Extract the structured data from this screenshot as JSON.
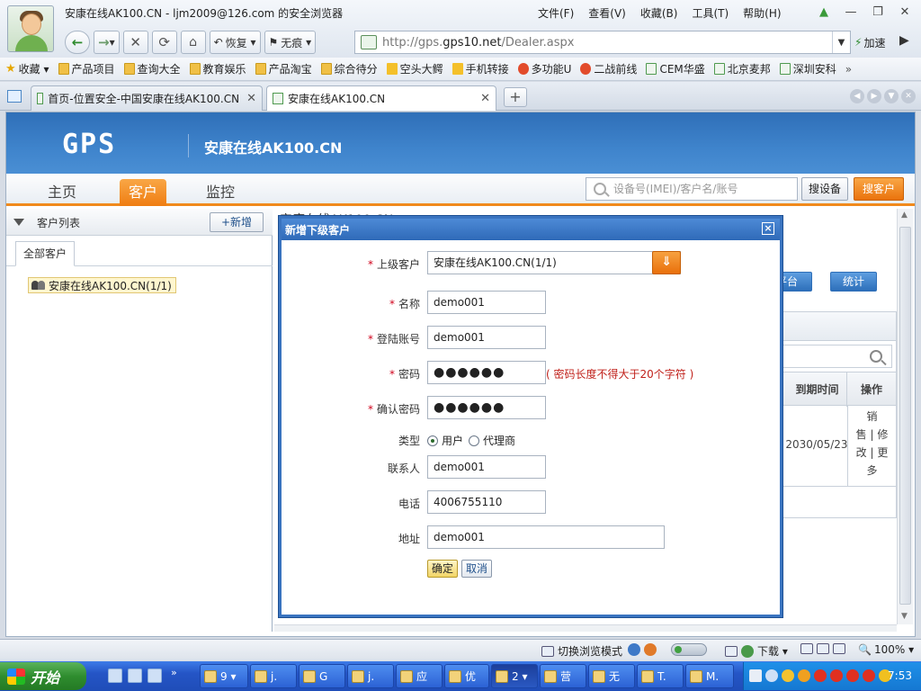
{
  "browser": {
    "window_title": "安康在线AK100.CN - ljm2009@126.com 的安全浏览器",
    "menu": [
      "文件(F)",
      "查看(V)",
      "收藏(B)",
      "工具(T)",
      "帮助(H)"
    ],
    "nav": {
      "restore": "恢复",
      "no_trace": "无痕"
    },
    "url_prefix": "http://gps.",
    "url_domain": "gps10.net",
    "url_path": "/Dealer.aspx",
    "speed_label": "加速",
    "favorites": [
      "收藏",
      "产品项目",
      "查询大全",
      "教育娱乐",
      "产品淘宝",
      "综合待分",
      "空头大鳄",
      "手机转接",
      "多功能U",
      "二战前线",
      "CEM华盛",
      "北京麦邦",
      "深圳安科"
    ],
    "tabs": [
      {
        "label": "首页-位置安全-中国安康在线AK100.CN"
      },
      {
        "label": "安康在线AK100.CN"
      }
    ]
  },
  "site": {
    "logo": "GPS",
    "name": "安康在线AK100.CN",
    "nav": [
      "主页",
      "客户",
      "监控"
    ],
    "search_placeholder": "设备号(IMEI)/客户名/账号",
    "search_device_btn": "搜设备",
    "search_customer_btn": "搜客户"
  },
  "left_panel": {
    "title": "客户列表",
    "add_btn": "+新增",
    "tab_all": "全部客户",
    "tree_node": "安康在线AK100.CN(1/1)"
  },
  "right_panel": {
    "title": "安康在线AK100.CN",
    "btn_platform": "平台",
    "btn_stats": "统计",
    "col_expire": "到期时间",
    "col_ops": "操作",
    "row_expire": "2030/05/23",
    "row_ops": [
      "销",
      "售 | 修",
      "改 | 更",
      "多"
    ]
  },
  "dialog": {
    "title": "新增下级客户",
    "close": "×",
    "required_mark": "*",
    "fields": {
      "parent": {
        "label": "上级客户",
        "value": "安康在线AK100.CN(1/1)"
      },
      "name": {
        "label": "名称",
        "value": "demo001"
      },
      "login": {
        "label": "登陆账号",
        "value": "demo001"
      },
      "password": {
        "label": "密码",
        "value": "●●●●●●",
        "hint": "( 密码长度不得大于20个字符 )"
      },
      "confirm": {
        "label": "确认密码",
        "value": "●●●●●●"
      },
      "type": {
        "label": "类型",
        "options": [
          "用户",
          "代理商"
        ],
        "selected": "用户"
      },
      "contact": {
        "label": "联系人",
        "value": "demo001"
      },
      "phone": {
        "label": "电话",
        "value": "4006755110"
      },
      "address": {
        "label": "地址",
        "value": "demo001"
      }
    },
    "ok": "确定",
    "cancel": "取消"
  },
  "statusbar": {
    "switch_mode": "切换浏览模式",
    "download": "下载",
    "zoom": "100%"
  },
  "taskbar": {
    "start": "开始",
    "tasks": [
      "9",
      "j.",
      "G",
      "j.",
      "应",
      "优",
      "2",
      "营",
      "无",
      "T.",
      "M."
    ],
    "clock": "7:53"
  },
  "colors": {
    "accent_blue": "#2f6fb8",
    "accent_orange": "#ef7d12",
    "required_red": "#d0021b"
  }
}
